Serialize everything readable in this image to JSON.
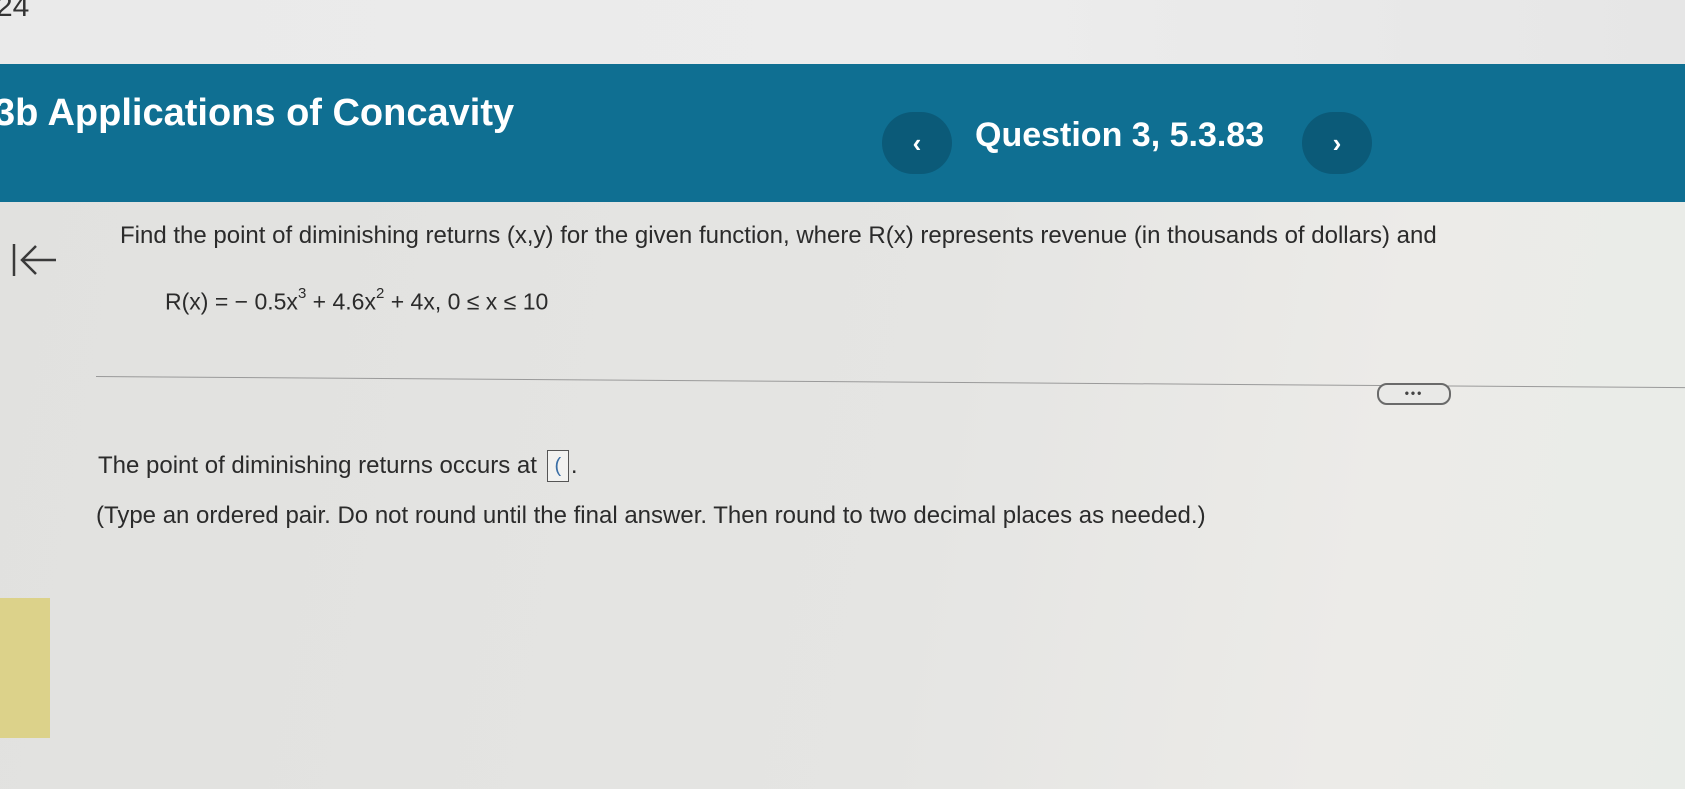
{
  "corner_text": "24",
  "header": {
    "section_title": "3b Applications of Concavity",
    "prev_icon": "chevron-left-icon",
    "next_icon": "chevron-right-icon",
    "prev_glyph": "‹",
    "next_glyph": "›",
    "question_label": "Question 3, 5.3.83",
    "background_color": "#0f6f92"
  },
  "nav": {
    "back_icon": "collapse-left-arrow-icon"
  },
  "problem": {
    "prompt": "Find the point of diminishing returns (x,y) for the given function, where R(x) represents revenue (in thousands of dollars) and",
    "equation": {
      "lhs": "R(x) = − 0.5x",
      "exp1": "3",
      "mid": " + 4.6x",
      "exp2": "2",
      "rhs": " + 4x, 0 ≤ x ≤ 10"
    }
  },
  "more_button": "•••",
  "answer": {
    "lead_text": "The point of diminishing returns occurs at",
    "input_value": "(",
    "suffix": ".",
    "instructions": "(Type an ordered pair. Do not round until the final answer. Then round to two decimal places as needed.)"
  }
}
